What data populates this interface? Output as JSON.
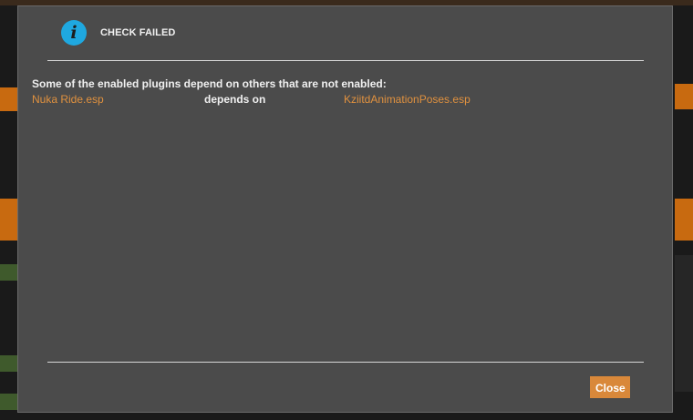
{
  "dialog": {
    "title": "CHECK FAILED",
    "icon": "info-icon",
    "message": "Some of the enabled plugins depend on others that are not enabled:",
    "dependencies": [
      {
        "plugin": "Nuka Ride.esp",
        "relation": "depends on",
        "requires": "KziitdAnimationPoses.esp"
      }
    ],
    "close_label": "Close"
  },
  "colors": {
    "accent": "#d9883a",
    "plugin_text": "#e0913f",
    "info_icon": "#1fa8e0",
    "dialog_bg": "#4b4b4b"
  }
}
